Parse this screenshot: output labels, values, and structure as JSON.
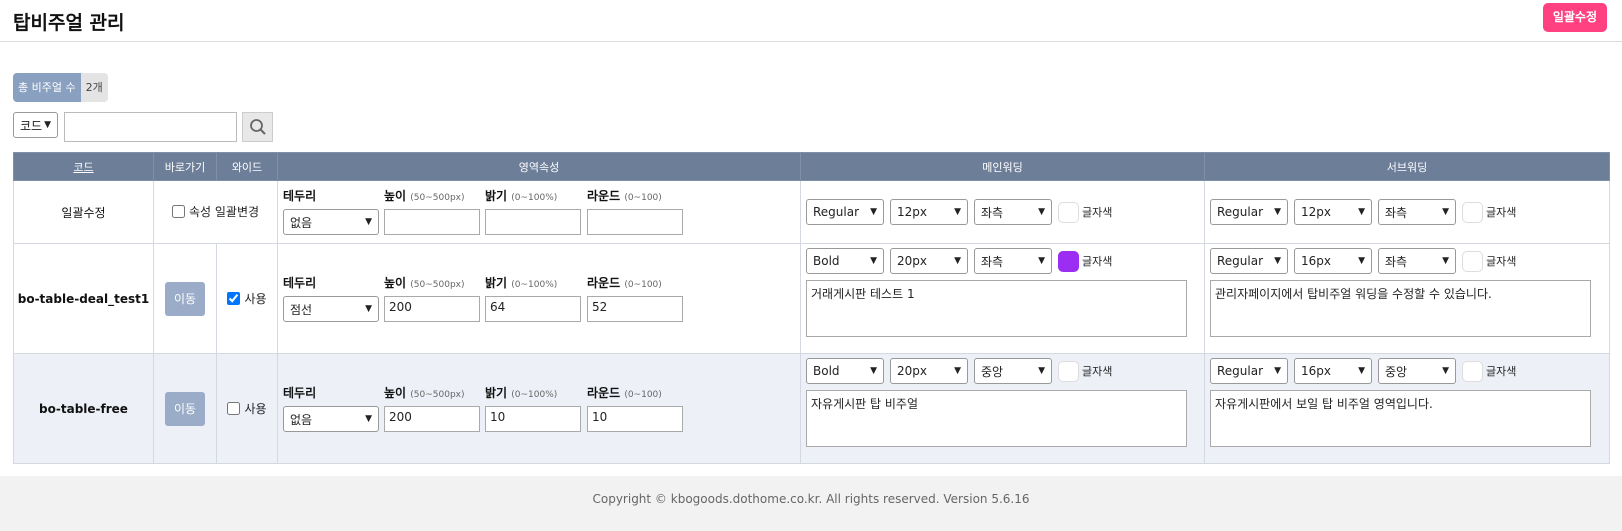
{
  "header": {
    "title": "탑비주얼 관리",
    "bulk_edit_label": "일괄수정"
  },
  "summary": {
    "count_label": "총 비주얼 수",
    "count_value": "2개"
  },
  "search": {
    "field_selected": "코드",
    "query": ""
  },
  "table": {
    "headers": {
      "code": "코드",
      "shortcut": "바로가기",
      "wide": "와이드",
      "area": "영역속성",
      "main": "메인워딩",
      "sub": "서브워딩"
    }
  },
  "area_labels": {
    "border": "테두리",
    "height": "높이",
    "height_hint": "(50~500px)",
    "brightness": "밝기",
    "brightness_hint": "(0~100%)",
    "round": "라운드",
    "round_hint": "(0~100)"
  },
  "color_label": "글자색",
  "bulk_row": {
    "code": "일괄수정",
    "bulk_attr_label": "속성 일괄변경",
    "border": "없음",
    "height": "",
    "brightness": "",
    "round": "",
    "main": {
      "weight": "Regular",
      "size": "12px",
      "align": "좌측",
      "color": "#ffffff"
    },
    "sub": {
      "weight": "Regular",
      "size": "12px",
      "align": "좌측",
      "color": "#ffffff"
    }
  },
  "rows": [
    {
      "code": "bo-table-deal_test1",
      "move_label": "이동",
      "use_label": "사용",
      "wide_checked": true,
      "border": "점선",
      "height": "200",
      "brightness": "64",
      "round": "52",
      "main": {
        "weight": "Bold",
        "size": "20px",
        "align": "좌측",
        "color": "#9b2ef2",
        "text": "거래게시판 테스트 1"
      },
      "sub": {
        "weight": "Regular",
        "size": "16px",
        "align": "좌측",
        "color": "#ffffff",
        "text": "관리자페이지에서 탑비주얼 워딩을 수정할 수 있습니다."
      }
    },
    {
      "code": "bo-table-free",
      "move_label": "이동",
      "use_label": "사용",
      "wide_checked": false,
      "border": "없음",
      "height": "200",
      "brightness": "10",
      "round": "10",
      "main": {
        "weight": "Bold",
        "size": "20px",
        "align": "중앙",
        "color": "#ffffff",
        "text": "자유게시판 탑 비주얼"
      },
      "sub": {
        "weight": "Regular",
        "size": "16px",
        "align": "중앙",
        "color": "#ffffff",
        "text": "자유게시판에서 보일 탑 비주얼 영역입니다."
      }
    }
  ],
  "footer": {
    "text": "Copyright © kbogoods.dothome.co.kr. All rights reserved. Version 5.6.16"
  },
  "colors": {
    "accent_pink": "#ff4081",
    "header_bg": "#6d7e99",
    "badge_blue": "#8aa0c0",
    "move_btn": "#9aacc8"
  }
}
